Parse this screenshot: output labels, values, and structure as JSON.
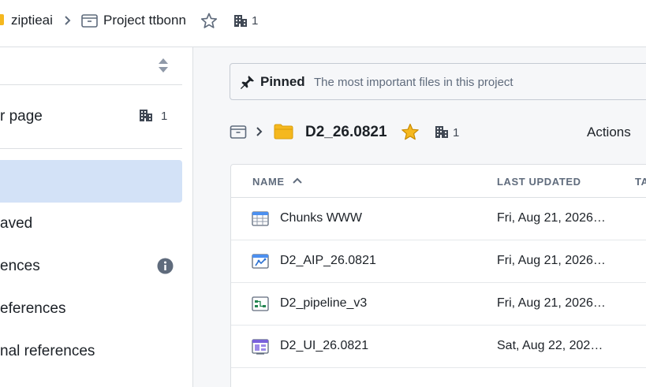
{
  "breadcrumb": {
    "org": "ziptieai",
    "project": "Project ttbonn",
    "members_count": "1"
  },
  "sidebar": {
    "items": [
      {
        "label": "r page",
        "count": "1"
      },
      {
        "label": ""
      },
      {
        "label": "aved"
      },
      {
        "label": "ences"
      },
      {
        "label": "eferences"
      },
      {
        "label": "nal references"
      }
    ]
  },
  "pinned": {
    "title": "Pinned",
    "description": "The most important files in this project"
  },
  "folder": {
    "name": "D2_26.0821",
    "members_count": "1",
    "actions_label": "Actions"
  },
  "table": {
    "columns": [
      "NAME",
      "LAST UPDATED",
      "TA"
    ],
    "rows": [
      {
        "name": "Chunks WWW",
        "updated": "Fri, Aug 21, 2026…",
        "icon": "table-icon"
      },
      {
        "name": "D2_AIP_26.0821",
        "updated": "Fri, Aug 21, 2026…",
        "icon": "aip-icon"
      },
      {
        "name": "D2_pipeline_v3",
        "updated": "Fri, Aug 21, 2026…",
        "icon": "pipeline-icon"
      },
      {
        "name": "D2_UI_26.0821",
        "updated": "Sat, Aug 22, 202…",
        "icon": "ui-app-icon"
      }
    ]
  },
  "colors": {
    "selected_row": "#d3e2f7",
    "star_fill": "#f5b81f",
    "folder_fill": "#f5b81f",
    "border": "#dcdfe3"
  }
}
